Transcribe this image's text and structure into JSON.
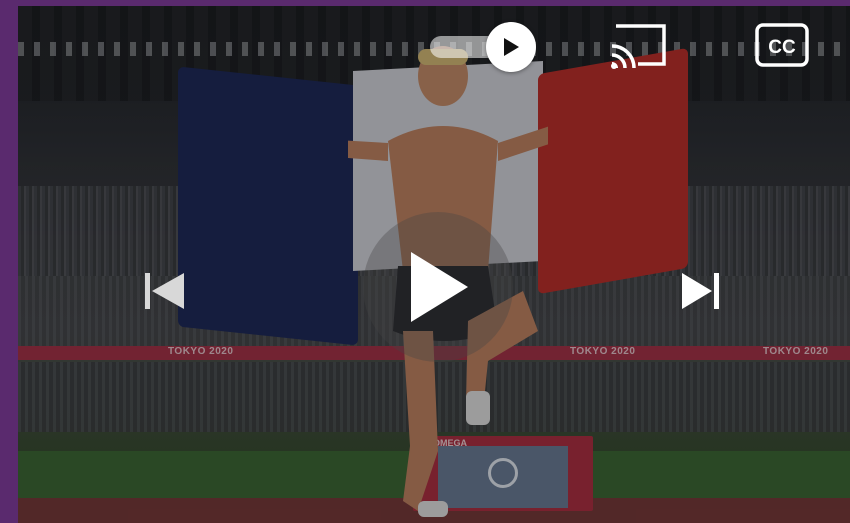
{
  "player": {
    "autoplay_toggle": {
      "state": "on",
      "icon": "play-icon"
    },
    "cast": {
      "icon": "cast-icon"
    },
    "captions": {
      "label": "CC",
      "icon": "closed-captions-icon"
    },
    "previous": {
      "icon": "skip-previous-icon"
    },
    "play": {
      "icon": "play-icon"
    },
    "next": {
      "icon": "skip-next-icon"
    }
  },
  "scene": {
    "banner_text": "TOKYO 2020",
    "sponsor_text": "OMEGA"
  },
  "colors": {
    "frame": "#5a2a6e",
    "control": "#ffffff",
    "flag_blue": "#1f2b5c",
    "flag_red": "#c0322d",
    "banner": "#a8344a"
  }
}
